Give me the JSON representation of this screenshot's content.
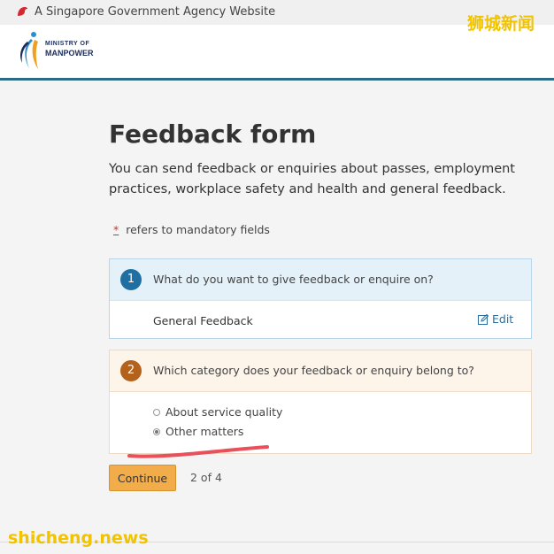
{
  "gov_bar": {
    "text": "A Singapore Government Agency Website"
  },
  "logo": {
    "line1": "MINISTRY OF",
    "line2": "MANPOWER"
  },
  "page": {
    "title": "Feedback form",
    "intro": "You can send feedback or enquiries about passes, employment practices, workplace safety and health and general feedback.",
    "mandatory_star": "*",
    "mandatory_note": "refers to mandatory fields"
  },
  "step1": {
    "number": "1",
    "question": "What do you want to give feedback or enquire on?",
    "answer": "General Feedback",
    "edit_label": "Edit"
  },
  "step2": {
    "number": "2",
    "question": "Which category does your feedback or enquiry belong to?",
    "options": [
      {
        "label": "About service quality",
        "selected": false
      },
      {
        "label": "Other matters",
        "selected": true
      }
    ]
  },
  "actions": {
    "continue_label": "Continue",
    "progress": "2 of 4"
  },
  "watermarks": {
    "top_right": "狮城新闻",
    "bottom_left": "shicheng.news"
  },
  "colors": {
    "header_rule": "#2b6b87",
    "step1_badge": "#1f6fa3",
    "step2_badge": "#b4611b",
    "continue_button": "#f2ad4a",
    "annotation_stroke": "#e8505b",
    "watermark": "#f2c300"
  }
}
